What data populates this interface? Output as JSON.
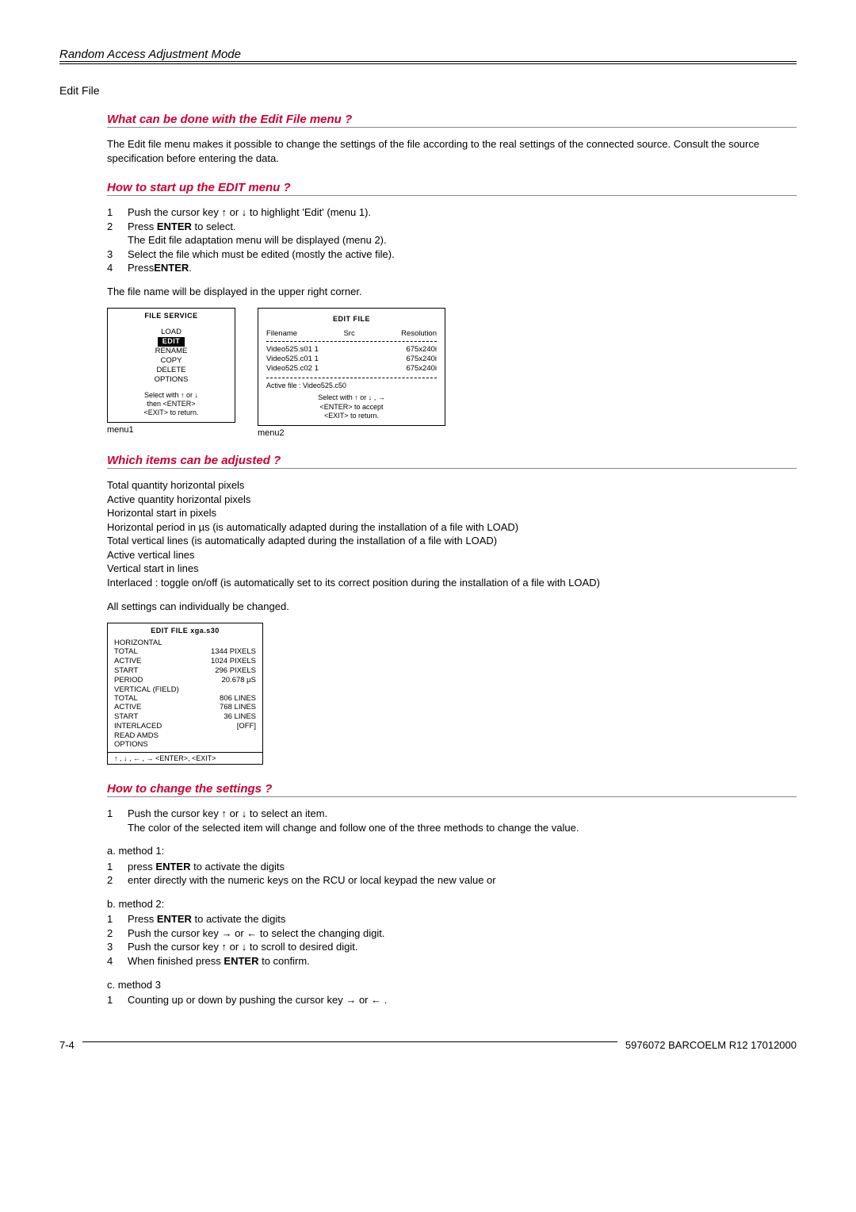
{
  "header": {
    "title": "Random Access Adjustment Mode"
  },
  "section_title": "Edit File",
  "s1": {
    "heading": "What can be done with the Edit File menu ?",
    "body": "The Edit file menu makes it possible to change the settings of the file according to the real settings of the connected source.  Consult the source specification before entering the data."
  },
  "s2": {
    "heading": "How to start up the EDIT menu ?",
    "step1_a": "Push the cursor key ",
    "step1_b": " or ",
    "step1_c": " to highlight 'Edit' (menu 1).",
    "step2_a": "Press ",
    "step2_b": "ENTER",
    "step2_c": " to select.",
    "step2_d": "The Edit file adaptation menu will be displayed (menu 2).",
    "step3": "Select the file which must be edited (mostly the active file).",
    "step4_a": "Press",
    "step4_b": "ENTER",
    "step4_c": ".",
    "body2": "The file name will be displayed in the upper right corner."
  },
  "menu1": {
    "title": "FILE  SERVICE",
    "items": [
      "LOAD",
      "EDIT",
      "RENAME",
      "COPY",
      "DELETE",
      "OPTIONS"
    ],
    "foot1": "Select with ↑ or ↓",
    "foot2": "then <ENTER>",
    "foot3": "<EXIT> to return.",
    "label": "menu1"
  },
  "menu2": {
    "title": "EDIT FILE",
    "col1": "Filename",
    "col2": "Src",
    "col3": "Resolution",
    "rows": [
      {
        "name": "Video525.s01",
        "src": "1",
        "res": "675x240i"
      },
      {
        "name": "Video525.c01",
        "src": "1",
        "res": "675x240i"
      },
      {
        "name": "Video525.c02",
        "src": "1",
        "res": "675x240i"
      }
    ],
    "active": "Active file : Video525.c50",
    "foot1": "Select with ↑  or ↓ , →",
    "foot2": "<ENTER> to accept",
    "foot3": "<EXIT> to return.",
    "label": "menu2"
  },
  "s3": {
    "heading": "Which items can be adjusted ?",
    "lines": [
      "Total quantity horizontal pixels",
      "Active quantity horizontal pixels",
      "Horizontal start in pixels",
      "Horizontal period in µs (is automatically adapted during the installation of  a file with LOAD)",
      "Total vertical lines (is automatically adapted during the installation of a file with LOAD)",
      "Active vertical lines",
      "Vertical start in lines",
      "Interlaced : toggle on/off (is automatically set to its correct position during the installation of a file with LOAD)"
    ],
    "body2": "All settings can individually be changed."
  },
  "menu3": {
    "title": "EDIT FILE    xga.s30",
    "h1": "HORIZONTAL",
    "rows1": [
      {
        "l": "TOTAL",
        "v": "1344 PIXELS"
      },
      {
        "l": "ACTIVE",
        "v": "1024 PIXELS"
      },
      {
        "l": "START",
        "v": "296 PIXELS"
      },
      {
        "l": "PERIOD",
        "v": "20.678 µS"
      }
    ],
    "h2": "VERTICAL (FIELD)",
    "rows2": [
      {
        "l": "TOTAL",
        "v": "806 LINES"
      },
      {
        "l": "ACTIVE",
        "v": "768 LINES"
      },
      {
        "l": "START",
        "v": "36 LINES"
      },
      {
        "l": "INTERLACED",
        "v": "[OFF]"
      }
    ],
    "extra": [
      "READ AMDS",
      "OPTIONS"
    ],
    "footer": "↑ , ↓ , ← , → <ENTER>, <EXIT>"
  },
  "s4": {
    "heading": "How to change the settings ?",
    "step1_a": "Push the cursor key ",
    "step1_b": " or ",
    "step1_c": " to select an item.",
    "step1_d": "The color of the selected item will change and follow one of the three methods to change the value.",
    "ma_h": "a. method 1:",
    "ma_1_a": "press ",
    "ma_1_b": "ENTER",
    "ma_1_c": " to activate the digits",
    "ma_2": "enter directly with the numeric keys on the RCU or local keypad the new value or",
    "mb_h": "b. method 2:",
    "mb_1_a": "Press ",
    "mb_1_b": "ENTER",
    "mb_1_c": " to activate the digits",
    "mb_2_a": "Push the cursor key ",
    "mb_2_b": " or ",
    "mb_2_c": " to select the changing digit.",
    "mb_3_a": "Push the cursor key ",
    "mb_3_b": " or ",
    "mb_3_c": " to scroll  to desired digit.",
    "mb_4_a": "When finished press ",
    "mb_4_b": "ENTER",
    "mb_4_c": " to confirm.",
    "mc_h": "c. method 3",
    "mc_1_a": "Counting up or down by pushing the cursor key ",
    "mc_1_b": " or ",
    "mc_1_c": " ."
  },
  "footer": {
    "left": "7-4",
    "right": "5976072 BARCOELM R12 17012000"
  },
  "arrows": {
    "up": "↑",
    "down": "↓",
    "left": "←",
    "right": "→"
  }
}
